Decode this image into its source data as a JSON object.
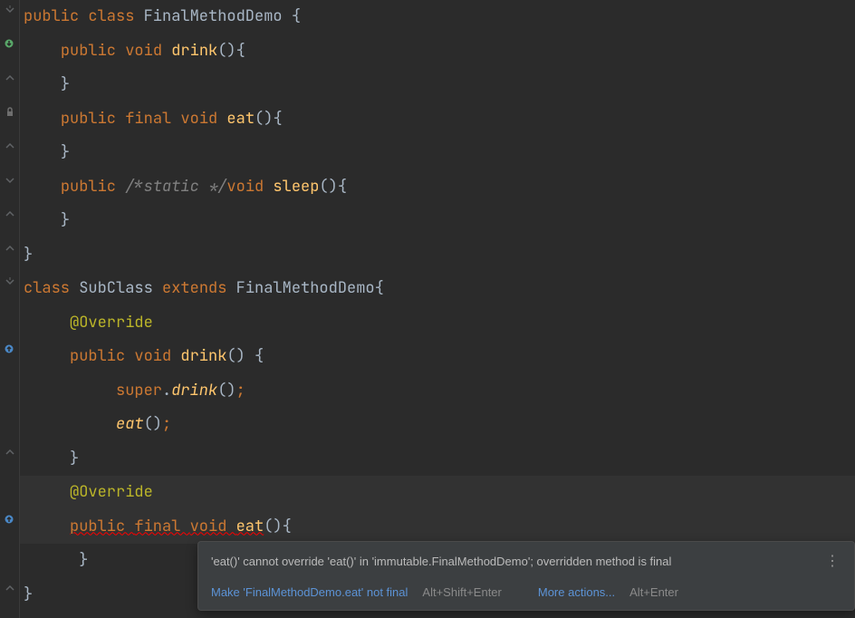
{
  "code": {
    "line1": {
      "kw1": "public ",
      "kw2": "class ",
      "cls": "FinalMethodDemo ",
      "brace": "{"
    },
    "line2": {
      "indent": "    ",
      "kw1": "public ",
      "kw2": "void ",
      "method": "drink",
      "parens": "()",
      "brace": "{"
    },
    "line3": {
      "indent": "    ",
      "brace": "}"
    },
    "line4": {
      "indent": "    ",
      "kw1": "public ",
      "kw2": "final ",
      "kw3": "void ",
      "method": "eat",
      "parens": "()",
      "brace": "{"
    },
    "line5": {
      "indent": "    ",
      "brace": "}"
    },
    "line6": {
      "indent": "    ",
      "kw1": "public ",
      "comment": "/*static */",
      "kw2": "void ",
      "method": "sleep",
      "parens": "()",
      "brace": "{"
    },
    "line7": {
      "indent": "    ",
      "brace": "}"
    },
    "line8": {
      "brace": "}"
    },
    "line9": {
      "kw1": "class ",
      "cls": "SubClass ",
      "kw2": "extends ",
      "cls2": "FinalMethodDemo",
      "brace": "{"
    },
    "line10": {
      "indent": "     ",
      "annot": "@Override"
    },
    "line11": {
      "indent": "     ",
      "kw1": "public ",
      "kw2": "void ",
      "method": "drink",
      "parens": "() ",
      "brace": "{"
    },
    "line12": {
      "indent": "          ",
      "kw": "super",
      "dot": ".",
      "method": "drink",
      "parens": "()",
      "semi": ";"
    },
    "line13": {
      "indent": "          ",
      "method": "eat",
      "parens": "()",
      "semi": ";"
    },
    "line14": {
      "indent": "     ",
      "brace": "}"
    },
    "line15": {
      "indent": "     ",
      "annot": "@Override"
    },
    "line16": {
      "indent": "     ",
      "kw1": "public ",
      "kw2": "final ",
      "kw3": "void ",
      "method": "eat",
      "parens": "()",
      "brace": "{"
    },
    "line17": {
      "indent": "      ",
      "brace": "}"
    },
    "line18": {
      "brace": "}"
    }
  },
  "tooltip": {
    "error": "'eat()' cannot override 'eat()' in 'immutable.FinalMethodDemo'; overridden method is final",
    "fix1": "Make 'FinalMethodDemo.eat' not final",
    "shortcut1": "Alt+Shift+Enter",
    "fix2": "More actions...",
    "shortcut2": "Alt+Enter"
  }
}
